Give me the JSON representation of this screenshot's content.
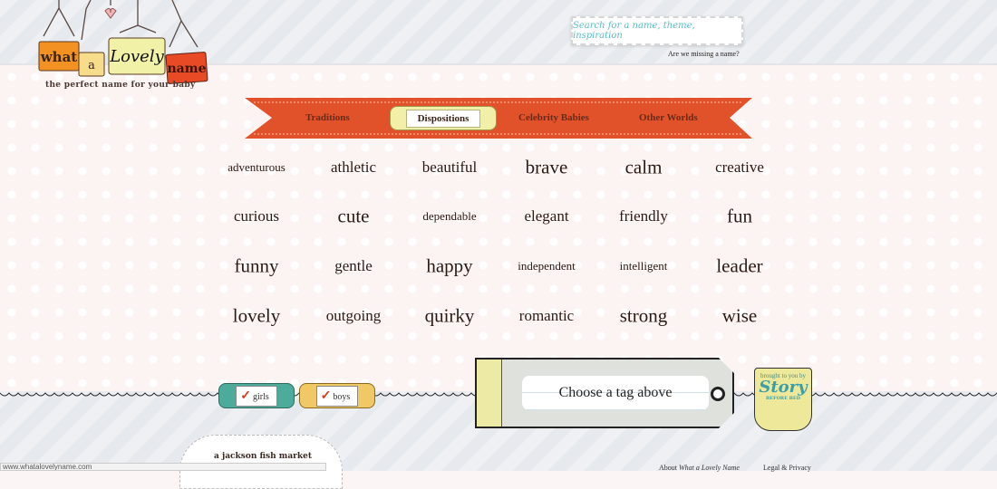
{
  "header": {
    "logo": {
      "words": [
        "what",
        "a",
        "Lovely",
        "name"
      ]
    },
    "tagline": "the perfect name for your baby",
    "search_placeholder": "Search for a name, theme, inspiration",
    "missing_link": "Are we missing a name?"
  },
  "nav": {
    "items": [
      {
        "label": "Traditions",
        "active": false
      },
      {
        "label": "Dispositions",
        "active": true
      },
      {
        "label": "Celebrity Babies",
        "active": false
      },
      {
        "label": "Other Worlds",
        "active": false
      }
    ]
  },
  "tags": [
    {
      "label": "adventurous",
      "size": "s"
    },
    {
      "label": "athletic",
      "size": "m"
    },
    {
      "label": "beautiful",
      "size": "m"
    },
    {
      "label": "brave",
      "size": "l"
    },
    {
      "label": "calm",
      "size": "l"
    },
    {
      "label": "creative",
      "size": "m"
    },
    {
      "label": "curious",
      "size": "m"
    },
    {
      "label": "cute",
      "size": "l"
    },
    {
      "label": "dependable",
      "size": "s"
    },
    {
      "label": "elegant",
      "size": "m"
    },
    {
      "label": "friendly",
      "size": "m"
    },
    {
      "label": "fun",
      "size": "l"
    },
    {
      "label": "funny",
      "size": "l"
    },
    {
      "label": "gentle",
      "size": "m"
    },
    {
      "label": "happy",
      "size": "l"
    },
    {
      "label": "independent",
      "size": "s"
    },
    {
      "label": "intelligent",
      "size": "s"
    },
    {
      "label": "leader",
      "size": "l"
    },
    {
      "label": "lovely",
      "size": "l"
    },
    {
      "label": "outgoing",
      "size": "m"
    },
    {
      "label": "quirky",
      "size": "l"
    },
    {
      "label": "romantic",
      "size": "m"
    },
    {
      "label": "strong",
      "size": "l"
    },
    {
      "label": "wise",
      "size": "l"
    }
  ],
  "filters": {
    "girls": {
      "label": "girls",
      "checked": true,
      "color": "#4dab9c"
    },
    "boys": {
      "label": "boys",
      "checked": true,
      "color": "#f0c865"
    }
  },
  "result_tag": "Choose a tag above",
  "sponsor": {
    "prefix": "brought to you by",
    "name": "Story",
    "sub": "BEFORE BED"
  },
  "footer": {
    "company": "a jackson fish market",
    "about_prefix": "About ",
    "about_italic": "What a Lovely Name",
    "legal": "Legal & Privacy",
    "status_url": "www.whatalovelyname.com"
  },
  "colors": {
    "ribbon": "#e2522a",
    "accent_teal": "#58bcc4",
    "text": "#2c1a14"
  }
}
